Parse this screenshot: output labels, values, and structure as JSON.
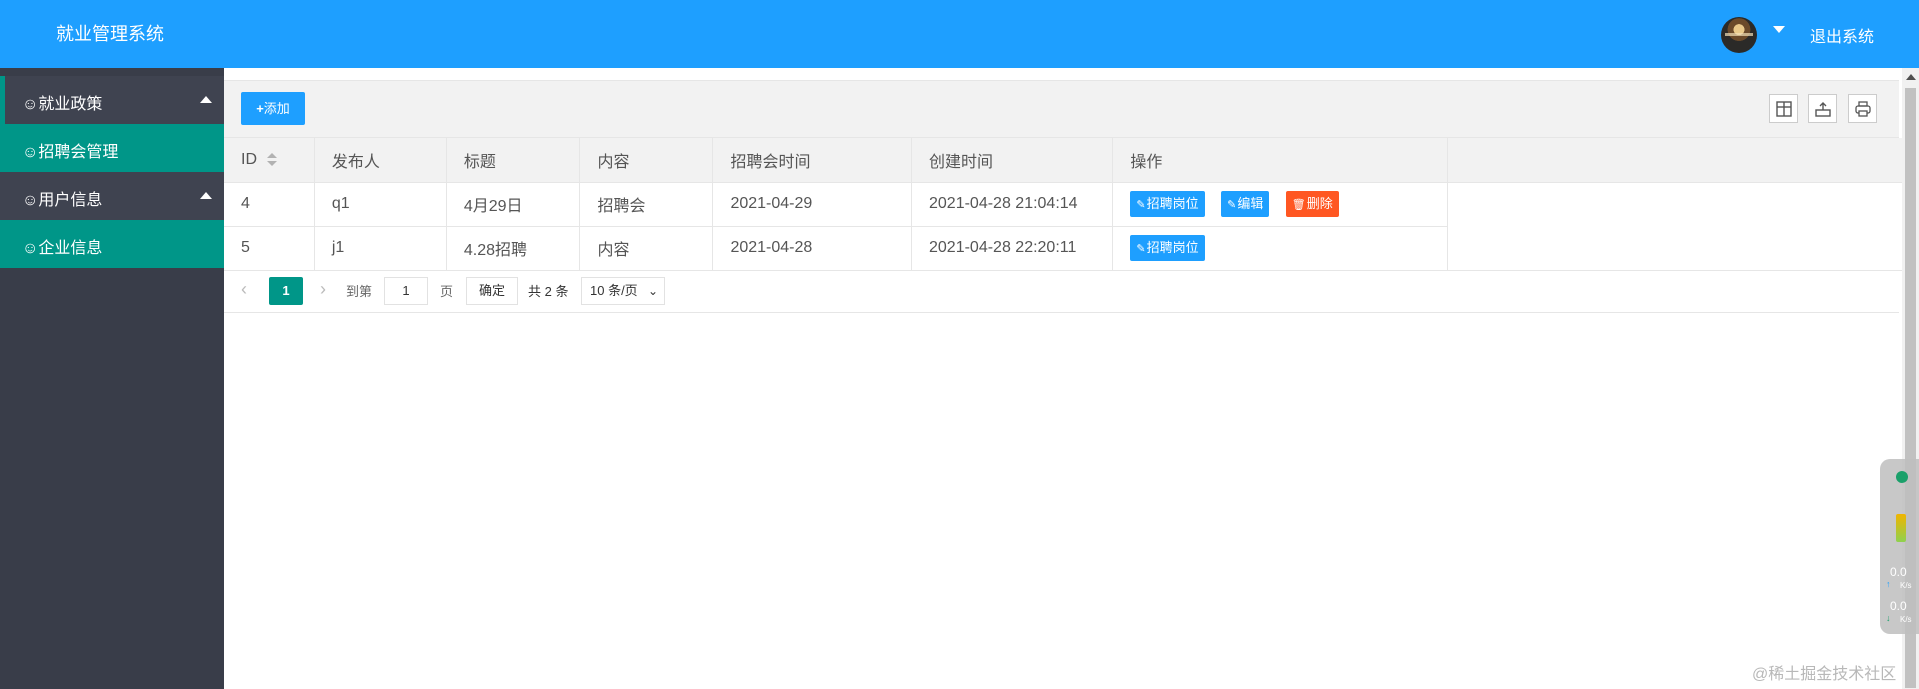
{
  "header": {
    "app_title": "就业管理系统",
    "logout_label": "退出系统"
  },
  "sidebar": {
    "groups": [
      {
        "label": "☺就业政策",
        "items": [
          {
            "label": "☺招聘会管理"
          }
        ]
      },
      {
        "label": "☺用户信息",
        "items": [
          {
            "label": "☺企业信息"
          }
        ]
      }
    ]
  },
  "toolbar": {
    "add_label": "添加",
    "add_icon": "plus-icon",
    "right_icons": [
      "columns-filter-icon",
      "export-icon",
      "print-icon"
    ]
  },
  "table": {
    "columns": [
      "ID",
      "发布人",
      "标题",
      "内容",
      "招聘会时间",
      "创建时间",
      "操作"
    ],
    "rows": [
      {
        "id": "4",
        "publisher": "q1",
        "title": "4月29日",
        "content": "招聘会",
        "fair_time": "2021-04-29",
        "created": "2021-04-28 21:04:14",
        "actions": {
          "jobs": "招聘岗位",
          "edit": "编辑",
          "delete": "删除"
        }
      },
      {
        "id": "5",
        "publisher": "j1",
        "title": "4.28招聘",
        "content": "内容",
        "fair_time": "2021-04-28",
        "created": "2021-04-28 22:20:11",
        "actions": {
          "jobs": "招聘岗位"
        }
      }
    ]
  },
  "pager": {
    "current_page": "1",
    "goto_prefix": "到第",
    "goto_value": "1",
    "goto_suffix": "页",
    "confirm_label": "确定",
    "total_label": "共 2 条",
    "limit_label": "10 条/页"
  },
  "netmon": {
    "up_rate": "0.0",
    "up_unit": "K/s",
    "down_rate": "0.0",
    "down_unit": "K/s"
  },
  "watermark": "@稀土掘金技术社区",
  "colors": {
    "header": "#1E9FFF",
    "sidebar": "#393D49",
    "sidebar_active": "#009688",
    "danger": "#FF5722"
  }
}
